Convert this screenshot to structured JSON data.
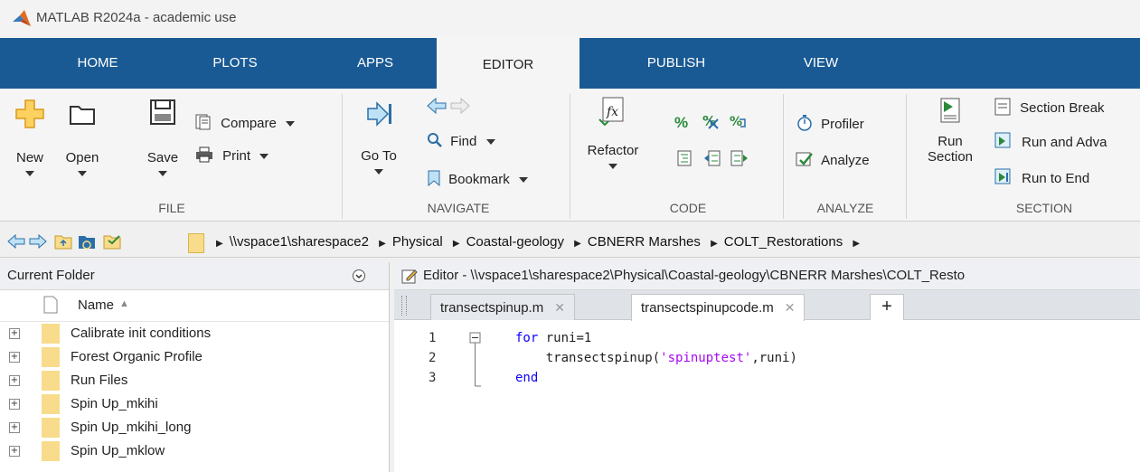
{
  "window": {
    "title": "MATLAB R2024a - academic use"
  },
  "tabs": [
    "HOME",
    "PLOTS",
    "APPS",
    "EDITOR",
    "PUBLISH",
    "VIEW"
  ],
  "active_tab": "EDITOR",
  "ribbon": {
    "file": {
      "label": "FILE",
      "new": "New",
      "open": "Open",
      "save": "Save",
      "compare": "Compare",
      "print": "Print"
    },
    "navigate": {
      "label": "NAVIGATE",
      "goto": "Go To",
      "find": "Find",
      "bookmark": "Bookmark"
    },
    "code": {
      "label": "CODE",
      "refactor": "Refactor"
    },
    "analyze": {
      "label": "ANALYZE",
      "profiler": "Profiler",
      "analyze": "Analyze"
    },
    "section": {
      "label": "SECTION",
      "run_section_1": "Run",
      "run_section_2": "Section",
      "section_break": "Section Break",
      "run_and_advance": "Run and Adva",
      "run_to_end": "Run to End"
    }
  },
  "address": {
    "crumbs": [
      "\\\\vspace1\\sharespace2",
      "Physical",
      "Coastal-geology",
      "CBNERR Marshes",
      "COLT_Restorations"
    ]
  },
  "current_folder": {
    "title": "Current Folder",
    "column_name": "Name",
    "sort": "▲",
    "items": [
      "Calibrate init conditions",
      "Forest Organic Profile",
      "Run Files",
      "Spin Up_mkihi",
      "Spin Up_mkihi_long",
      "Spin Up_mklow"
    ]
  },
  "editor": {
    "title": "Editor - \\\\vspace1\\sharespace2\\Physical\\Coastal-geology\\CBNERR Marshes\\COLT_Resto",
    "tabs": [
      {
        "name": "transectspinup.m"
      },
      {
        "name": "transectspinupcode.m"
      }
    ],
    "new_tab": "+",
    "line_numbers": [
      "1",
      "2",
      "3"
    ],
    "code": {
      "l1_kw": "for",
      "l1_rest": " runi=1",
      "l2_pre": "    transectspinup(",
      "l2_str": "'spinuptest'",
      "l2_post": ",runi)",
      "l3_kw": "end"
    }
  },
  "colors": {
    "tab_bar": "#1a5a94",
    "folder": "#f8dc8c",
    "keyword": "#0e00ff",
    "string": "#a709f5"
  }
}
